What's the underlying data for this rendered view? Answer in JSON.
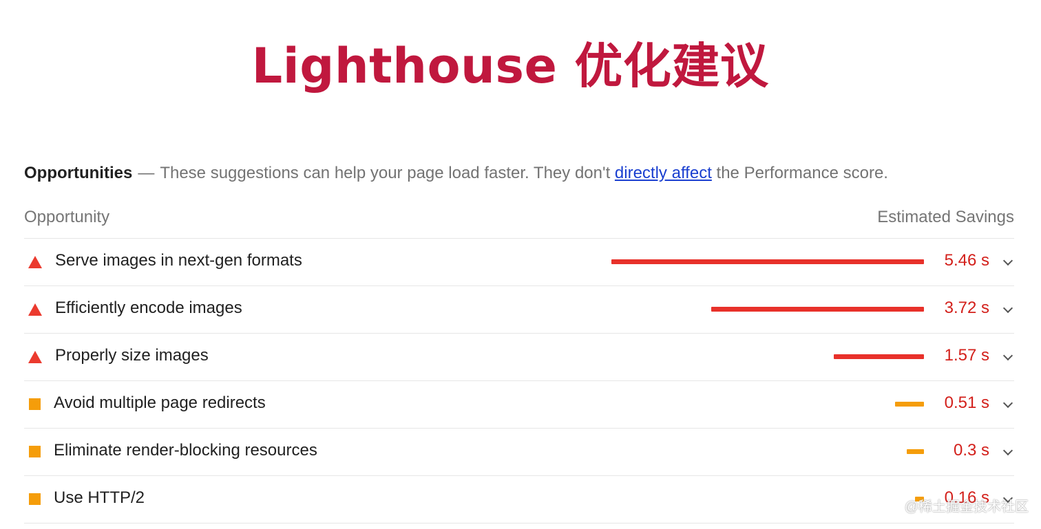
{
  "title": "Lighthouse 优化建议",
  "section": {
    "heading": "Opportunities",
    "dash": "—",
    "text_before_link": "These suggestions can help your page load faster. They don't",
    "link": "directly affect",
    "text_after_link": "the Performance score."
  },
  "columns": {
    "left": "Opportunity",
    "right": "Estimated Savings"
  },
  "colors": {
    "title": "#c0183e",
    "fail": "#e8312a",
    "average": "#f59d0a",
    "value": "#d3201b",
    "link": "#1a3fd0"
  },
  "opportunities": [
    {
      "label": "Serve images in next-gen formats",
      "savings": "5.46 s",
      "seconds": 5.46,
      "status": "fail",
      "icon": "red-triangle-icon"
    },
    {
      "label": "Efficiently encode images",
      "savings": "3.72 s",
      "seconds": 3.72,
      "status": "fail",
      "icon": "red-triangle-icon"
    },
    {
      "label": "Properly size images",
      "savings": "1.57 s",
      "seconds": 1.57,
      "status": "fail",
      "icon": "red-triangle-icon"
    },
    {
      "label": "Avoid multiple page redirects",
      "savings": "0.51 s",
      "seconds": 0.51,
      "status": "average",
      "icon": "orange-square-icon"
    },
    {
      "label": "Eliminate render-blocking resources",
      "savings": "0.3 s",
      "seconds": 0.3,
      "status": "average",
      "icon": "orange-square-icon"
    },
    {
      "label": "Use HTTP/2",
      "savings": "0.16 s",
      "seconds": 0.16,
      "status": "average",
      "icon": "orange-square-icon"
    }
  ],
  "watermark": "@稀土掘金技术社区"
}
